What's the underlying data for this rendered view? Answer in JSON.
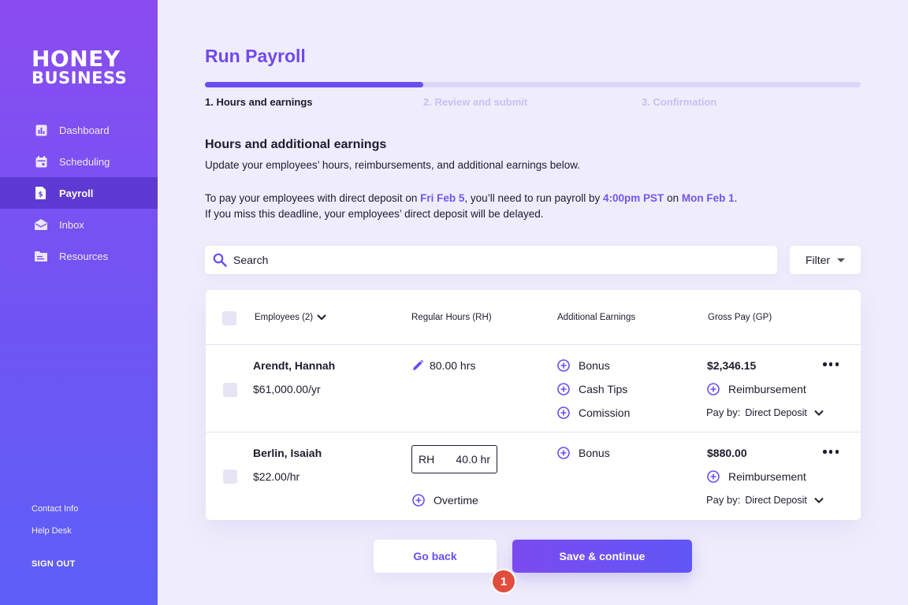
{
  "sidebar": {
    "logo_line1": "HONEY",
    "logo_line2": "BUSINESS",
    "items": [
      {
        "label": "Dashboard",
        "icon": "chart-icon"
      },
      {
        "label": "Scheduling",
        "icon": "calendar-icon"
      },
      {
        "label": "Payroll",
        "icon": "dollar-document-icon",
        "active": true
      },
      {
        "label": "Inbox",
        "icon": "envelope-icon"
      },
      {
        "label": "Resources",
        "icon": "folder-icon"
      }
    ],
    "contact_info": "Contact Info",
    "help_desk": "Help Desk",
    "sign_out": "SIGN OUT"
  },
  "header": {
    "title": "Run Payroll",
    "progress": 0.333,
    "steps": [
      "1. Hours and earnings",
      "2. Review and submit",
      "3. Confirmation"
    ]
  },
  "section": {
    "title": "Hours and additional earnings",
    "subtitle": "Update your employees’ hours, reimbursements, and additional earnings below.",
    "deadline": {
      "t1": "To pay your employees with direct deposit on ",
      "date": "Fri Feb 5",
      "t2": ", you’ll need to run payroll by ",
      "time": "4:00pm PST",
      "t3": " on ",
      "run_date": "Mon Feb 1",
      "t4": ".",
      "line2": "If you miss this deadline, your employees’ direct deposit will be delayed."
    }
  },
  "search": {
    "placeholder": "Search"
  },
  "filter": {
    "label": "Filter"
  },
  "table": {
    "columns": [
      "Employees (2)",
      "Regular Hours (RH)",
      "Additional Earnings",
      "Gross Pay (GP)"
    ],
    "rows": [
      {
        "name": "Arendt, Hannah",
        "rate": "$61,000.00/yr",
        "hours": "80.00 hrs",
        "earnings": [
          "Bonus",
          "Cash Tips",
          "Comission"
        ],
        "gross": "$2,346.15",
        "reimbursement": "Reimbursement",
        "pay_by_label": "Pay by:",
        "pay_by": "Direct Deposit"
      },
      {
        "name": "Berlin, Isaiah",
        "rate": "$22.00/hr",
        "rh_label": "RH",
        "rh_value": "40.0 hr",
        "overtime": "Overtime",
        "earnings": [
          "Bonus"
        ],
        "gross": "$880.00",
        "reimbursement": "Reimbursement",
        "pay_by_label": "Pay by:",
        "pay_by": "Direct Deposit"
      }
    ]
  },
  "buttons": {
    "back": "Go back",
    "save": "Save & continue"
  },
  "badge": "1",
  "colors": {
    "accent": "#6a4ef2",
    "badge": "#e24c3c",
    "background": "#efedfb"
  }
}
